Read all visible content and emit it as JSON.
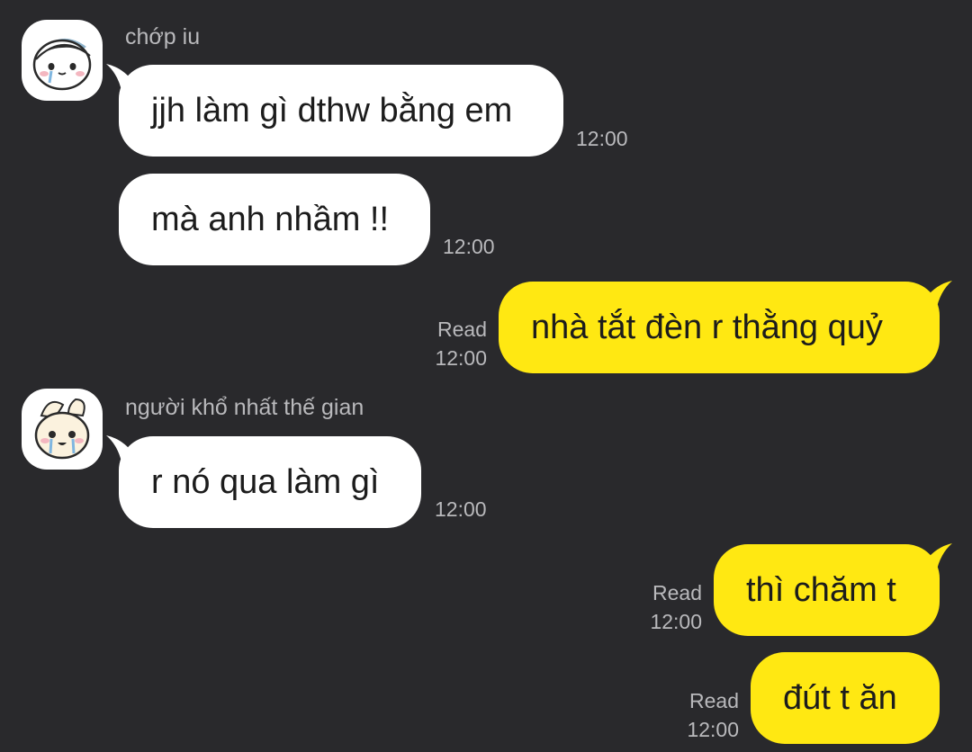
{
  "colors": {
    "background": "#29292c",
    "incoming_bubble": "#ffffff",
    "outgoing_bubble": "#ffe812",
    "meta_text": "#b9b9bc"
  },
  "messages": [
    {
      "direction": "in",
      "sender": "chớp iu",
      "avatar_icon": "crying-chiikawa-avatar-icon",
      "text": "jjh làm gì dthw bằng em",
      "time": "12:00"
    },
    {
      "direction": "in",
      "text": "mà anh nhầm !!",
      "time": "12:00"
    },
    {
      "direction": "out",
      "text": "nhà tắt đèn r thằng quỷ",
      "status": "Read",
      "time": "12:00"
    },
    {
      "direction": "in",
      "sender": "người khổ nhất thế gian",
      "avatar_icon": "crying-bunny-avatar-icon",
      "text": "r nó qua làm gì",
      "time": "12:00"
    },
    {
      "direction": "out",
      "text": "thì chăm t",
      "status": "Read",
      "time": "12:00"
    },
    {
      "direction": "out",
      "text": "đút t ăn",
      "status": "Read",
      "time": "12:00"
    }
  ]
}
